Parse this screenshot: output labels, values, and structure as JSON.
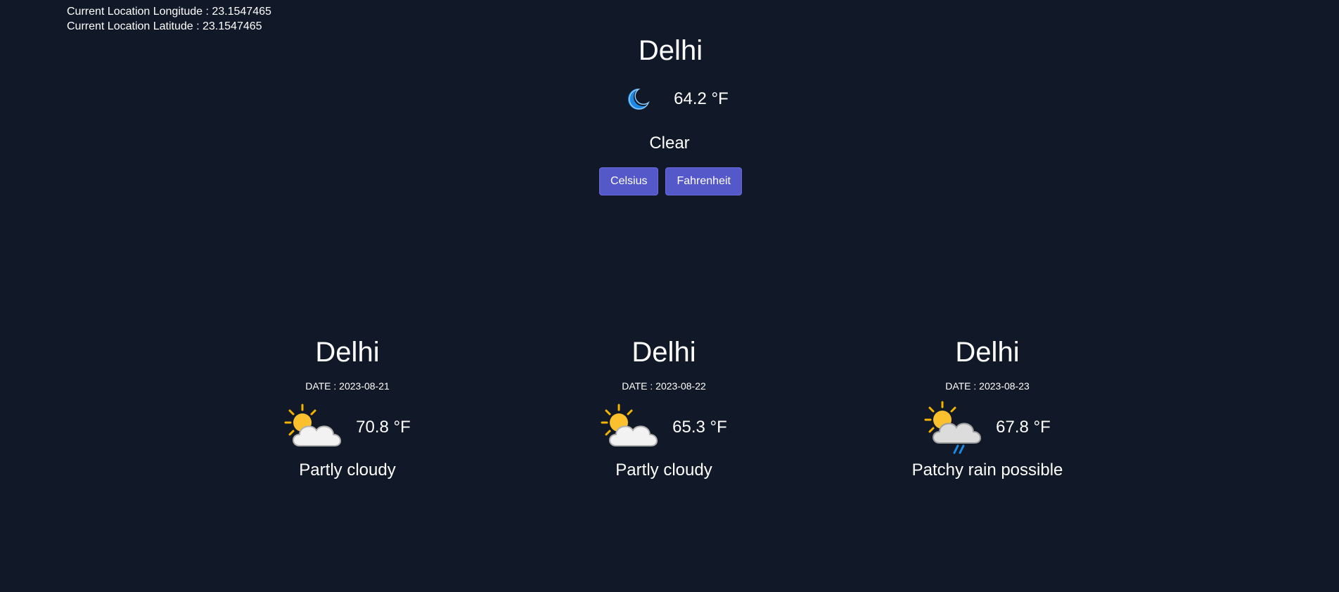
{
  "location": {
    "longitude_line": "Current Location Longitude : 23.1547465",
    "latitude_line": "Current Location Latitude : 23.1547465"
  },
  "current": {
    "city": "Delhi",
    "icon": "moon-icon",
    "temperature": "64.2 °F",
    "condition": "Clear"
  },
  "units": {
    "celsius_label": "Celsius",
    "fahrenheit_label": "Fahrenheit"
  },
  "forecast": [
    {
      "city": "Delhi",
      "date": "DATE : 2023-08-21",
      "icon": "partly-cloudy-icon",
      "temperature": "70.8 °F",
      "condition": "Partly cloudy"
    },
    {
      "city": "Delhi",
      "date": "DATE : 2023-08-22",
      "icon": "partly-cloudy-icon",
      "temperature": "65.3 °F",
      "condition": "Partly cloudy"
    },
    {
      "city": "Delhi",
      "date": "DATE : 2023-08-23",
      "icon": "patchy-rain-icon",
      "temperature": "67.8 °F",
      "condition": "Patchy rain possible"
    }
  ],
  "colors": {
    "background": "#111827",
    "button": "#5558c8",
    "text": "#ffffff"
  }
}
